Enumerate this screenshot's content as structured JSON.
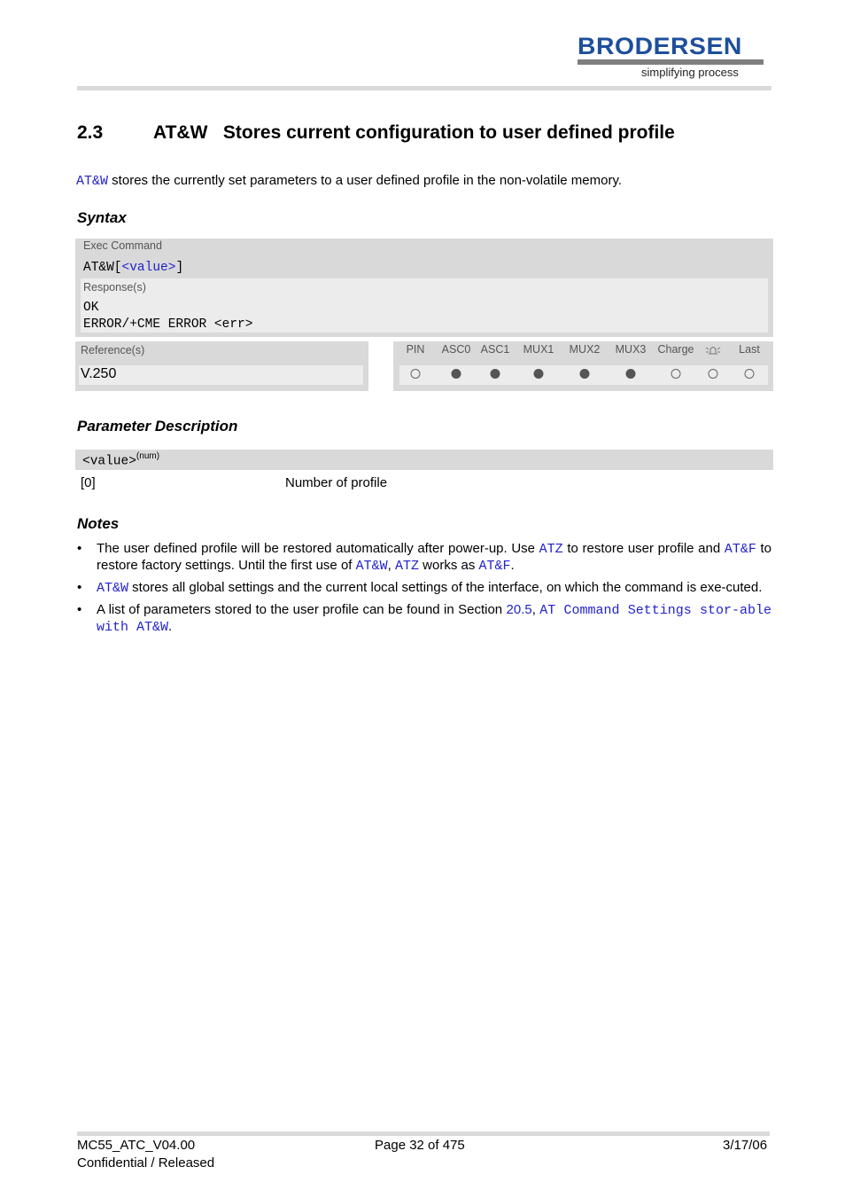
{
  "header": {
    "logo_text": "BRODERSEN",
    "logo_tagline": "simplifying process",
    "brand_color": "#1d4f9c"
  },
  "section": {
    "number": "2.3",
    "title": "AT&W   Stores current configuration to user defined profile"
  },
  "intro": {
    "command_link": "AT&W",
    "text": " stores the currently set parameters to a user defined profile in the non-volatile memory."
  },
  "syntax": {
    "heading": "Syntax",
    "exec_label": "Exec Command",
    "command_prefix": "AT&W[",
    "command_param": "<value>",
    "command_suffix": "]",
    "response_label": "Response(s)",
    "responses": [
      "OK",
      "ERROR/+CME ERROR <err>"
    ],
    "reference_label": "Reference(s)",
    "reference_value": "V.250",
    "flags": [
      {
        "label": "PIN",
        "state": "off"
      },
      {
        "label": "ASC0",
        "state": "on"
      },
      {
        "label": "ASC1",
        "state": "on"
      },
      {
        "label": "MUX1",
        "state": "on"
      },
      {
        "label": "MUX2",
        "state": "on"
      },
      {
        "label": "MUX3",
        "state": "on"
      },
      {
        "label": "Charge",
        "state": "off"
      },
      {
        "label": "alarm-icon",
        "state": "off"
      },
      {
        "label": "Last",
        "state": "off"
      }
    ]
  },
  "parameters": {
    "heading": "Parameter Description",
    "name": "<value>",
    "type": "(num)",
    "rows": [
      {
        "value": "[0]",
        "description": "Number of profile"
      }
    ]
  },
  "notes": {
    "heading": "Notes",
    "n1": {
      "a": "The user defined profile will be restored automatically after power-up. Use ",
      "l1": "ATZ",
      "b": " to restore user profile and ",
      "l2": "AT&F",
      "c": " to restore factory settings. Until the first use of ",
      "l3": "AT&W",
      "d": ", ",
      "l4": "ATZ",
      "e": " works as ",
      "l5": "AT&F",
      "f": "."
    },
    "n2": {
      "l1": "AT&W",
      "a": " stores all global settings and the current local settings of the interface, on which the command is exe-cuted."
    },
    "n3": {
      "a": "A list of parameters stored to the user profile can be found in Section ",
      "l1": "20.5",
      "b": ", ",
      "l2": "AT Command Settings stor-able with AT&W",
      "c": "."
    }
  },
  "footer": {
    "doc_id": "MC55_ATC_V04.00",
    "status": "Confidential / Released",
    "page": "Page 32 of 475",
    "date": "3/17/06"
  }
}
